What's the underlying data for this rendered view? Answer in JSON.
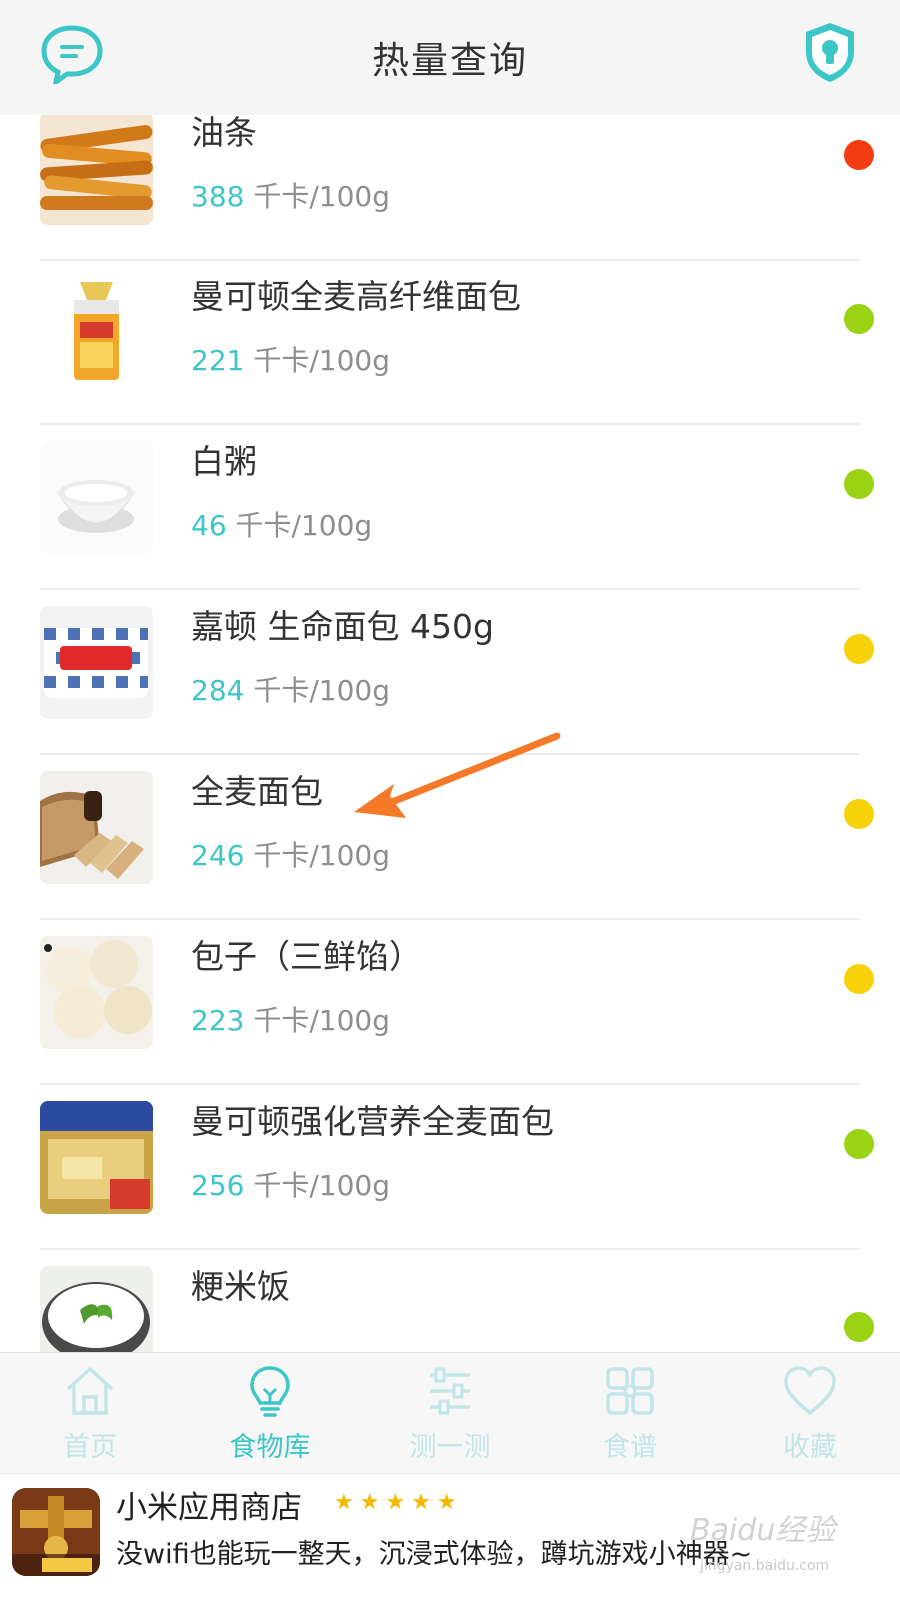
{
  "header": {
    "title": "热量查询",
    "left_icon": "chat-bubble-icon",
    "right_icon": "shield-keyhole-icon"
  },
  "colors": {
    "accent": "#3cc6c8",
    "dot_red": "#f23c12",
    "dot_green": "#9ad214",
    "dot_yellow": "#f7d20a",
    "arrow": "#f47a2a"
  },
  "foods": [
    {
      "name": "油条",
      "kcal": "388",
      "unit": "千卡/100g",
      "level": "red"
    },
    {
      "name": "曼可顿全麦高纤维面包",
      "kcal": "221",
      "unit": "千卡/100g",
      "level": "green"
    },
    {
      "name": "白粥",
      "kcal": "46",
      "unit": "千卡/100g",
      "level": "green"
    },
    {
      "name": "嘉顿 生命面包 450g",
      "kcal": "284",
      "unit": "千卡/100g",
      "level": "yellow"
    },
    {
      "name": "全麦面包",
      "kcal": "246",
      "unit": "千卡/100g",
      "level": "yellow"
    },
    {
      "name": "包子（三鲜馅）",
      "kcal": "223",
      "unit": "千卡/100g",
      "level": "yellow"
    },
    {
      "name": "曼可顿强化营养全麦面包",
      "kcal": "256",
      "unit": "千卡/100g",
      "level": "green"
    },
    {
      "name": "粳米饭",
      "kcal": "",
      "unit": "",
      "level": "green"
    }
  ],
  "bottom_nav": [
    {
      "label": "首页",
      "icon": "home-icon",
      "active": false
    },
    {
      "label": "食物库",
      "icon": "lightbulb-icon",
      "active": true
    },
    {
      "label": "测一测",
      "icon": "sliders-icon",
      "active": false
    },
    {
      "label": "食谱",
      "icon": "grid-icon",
      "active": false
    },
    {
      "label": "收藏",
      "icon": "heart-icon",
      "active": false
    }
  ],
  "ad": {
    "title": "小米应用商店",
    "rating_stars": "★★★★★",
    "description": "没wifi也能玩一整天，沉浸式体验，蹲坑游戏小神器~"
  },
  "watermark": {
    "text": "Baidu经验",
    "sub": "jingyan.baidu.com"
  }
}
